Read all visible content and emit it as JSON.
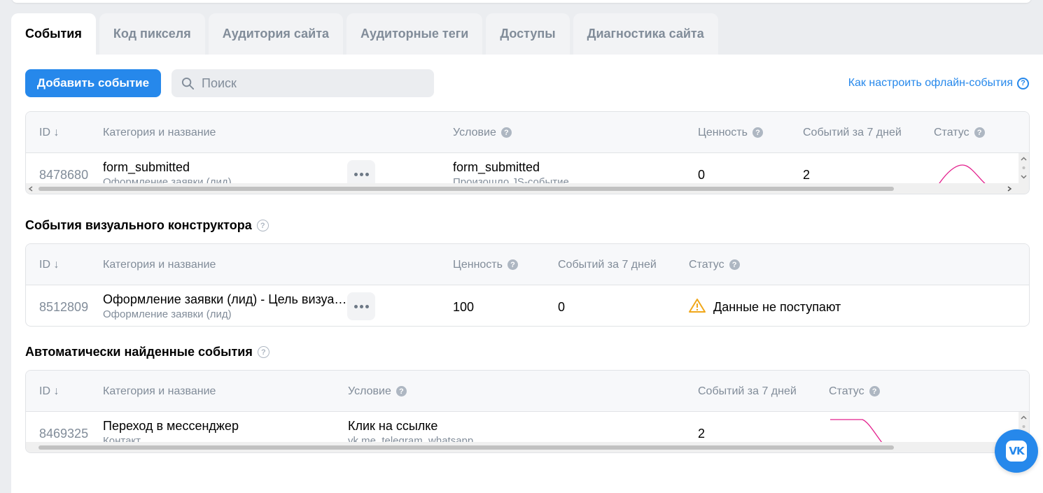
{
  "tabs": [
    {
      "label": "События",
      "active": true
    },
    {
      "label": "Код пикселя"
    },
    {
      "label": "Аудитория сайта"
    },
    {
      "label": "Аудиторные теги"
    },
    {
      "label": "Доступы"
    },
    {
      "label": "Диагностика сайта"
    }
  ],
  "toolbar": {
    "add_label": "Добавить событие",
    "search_placeholder": "Поиск",
    "help_link": "Как настроить офлайн-события",
    "help_icon": "?"
  },
  "events_table": {
    "headers": {
      "id": "ID ↓",
      "name": "Категория и название",
      "condition": "Условие",
      "value": "Ценность",
      "count": "Событий за 7 дней",
      "status": "Статус"
    },
    "rows": [
      {
        "id": "8478680",
        "name": "form_submitted",
        "category": "Оформление заявки (лид)",
        "condition": "form_submitted",
        "condition_sub": "Произошло JS-событие",
        "value": "0",
        "count": "2"
      }
    ]
  },
  "visual_section": {
    "title": "События визуального конструктора",
    "headers": {
      "id": "ID ↓",
      "name": "Категория и название",
      "value": "Ценность",
      "count": "Событий за 7 дней",
      "status": "Статус"
    },
    "rows": [
      {
        "id": "8512809",
        "name": "Оформление заявки (лид) - Цель визуа…",
        "category": "Оформление заявки (лид)",
        "value": "100",
        "count": "0",
        "status": "Данные не поступают"
      }
    ]
  },
  "auto_section": {
    "title": "Автоматически найденные события",
    "headers": {
      "id": "ID ↓",
      "name": "Категория и название",
      "condition": "Условие",
      "count": "Событий за 7 дней",
      "status": "Статус"
    },
    "rows": [
      {
        "id": "8469325",
        "name": "Переход в мессенджер",
        "category": "Контакт",
        "condition": "Клик на ссылке",
        "condition_sub": "vk.me, telegram, whatsapp",
        "count": "2"
      }
    ]
  },
  "widget": {
    "label": "VK"
  },
  "colors": {
    "accent": "#2688eb",
    "sparkline": "#e3208d",
    "warning": "#f0a71a"
  },
  "icons": [
    "search-icon",
    "question-circle-icon",
    "more-dots-icon",
    "warning-icon",
    "vk-logo-icon",
    "chevron-right-icon",
    "chevron-up-icon",
    "chevron-down-icon"
  ]
}
